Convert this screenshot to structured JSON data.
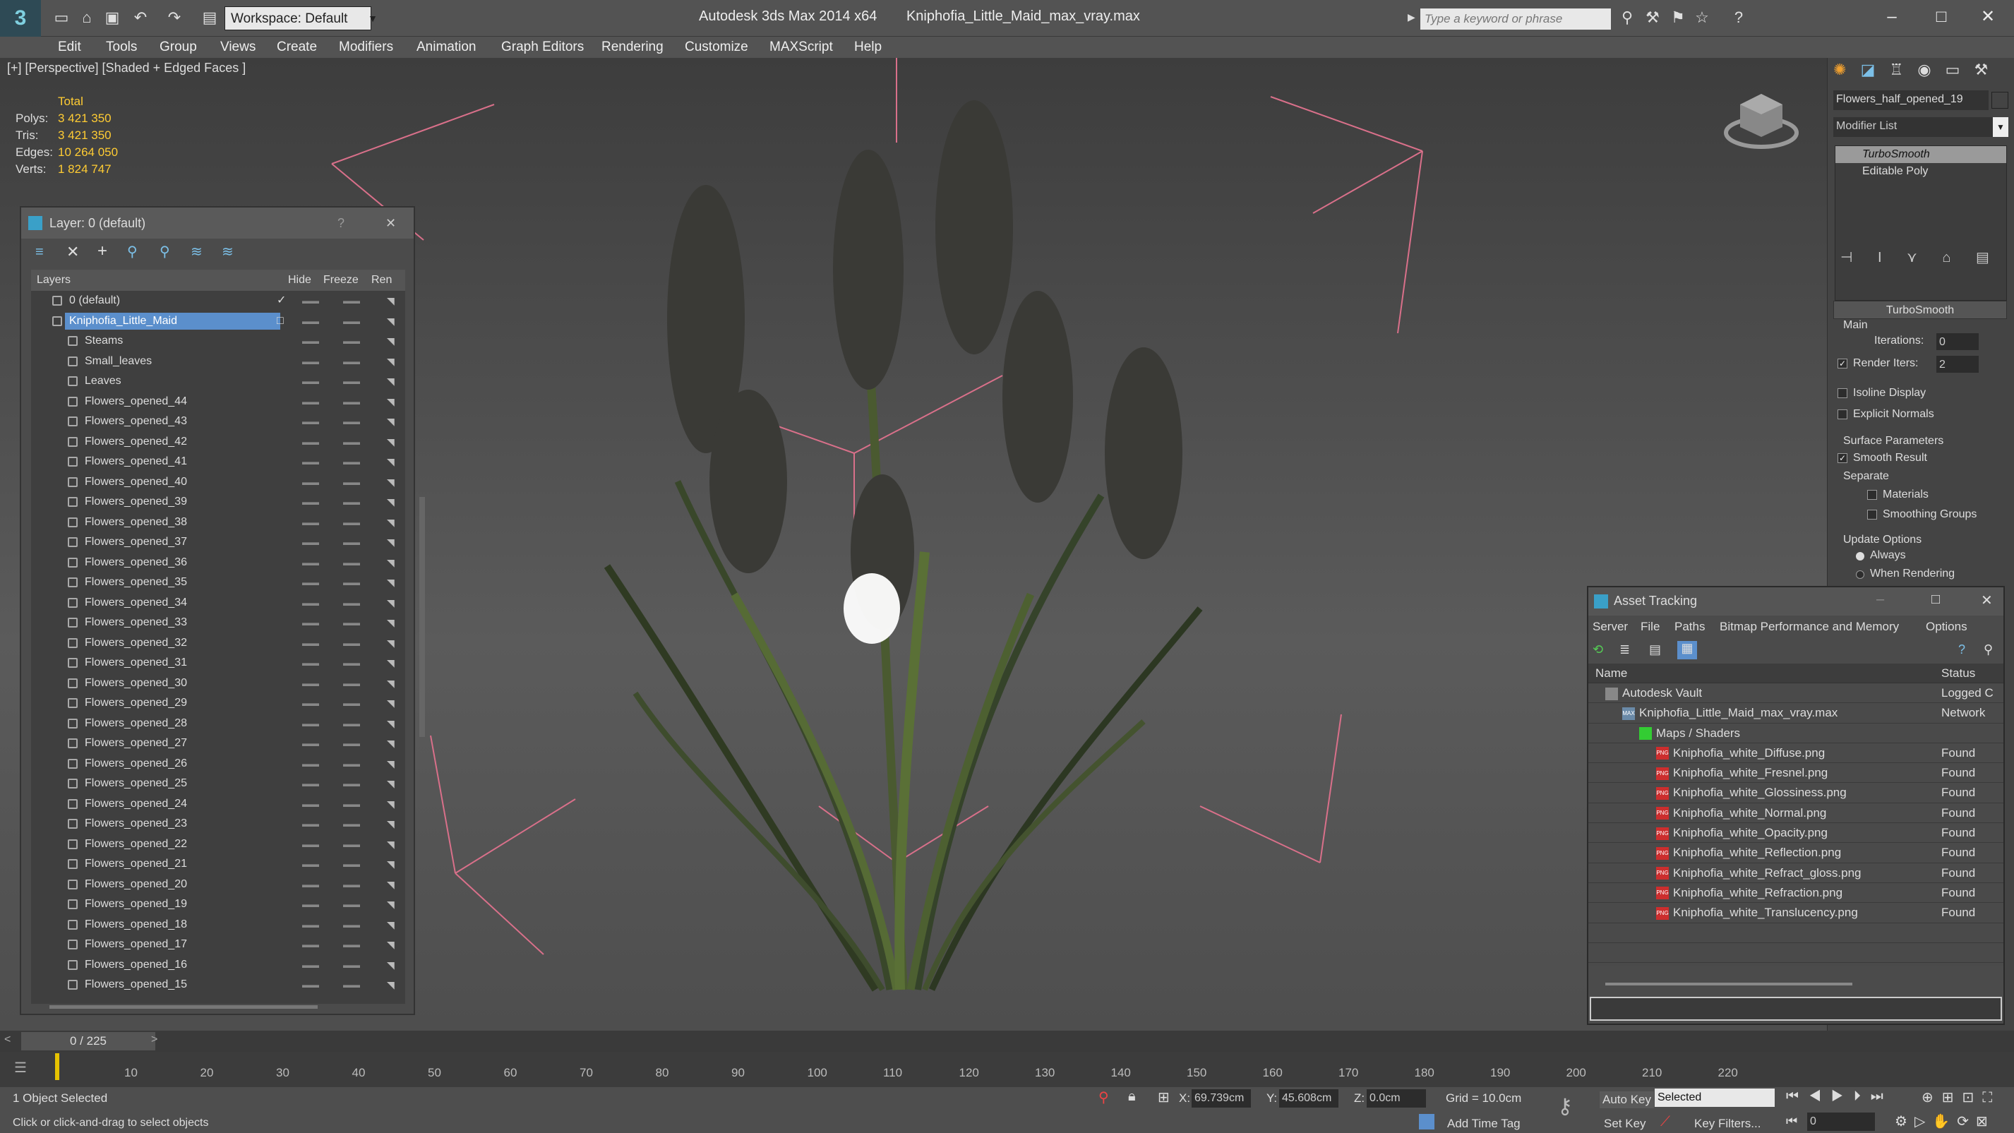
{
  "app": {
    "title": "Autodesk 3ds Max  2014 x64",
    "file": "Kniphofia_Little_Maid_max_vray.max",
    "logo_icon": "3ds-max-logo-icon",
    "workspace": "Workspace: Default",
    "search_placeholder": "Type a keyword or phrase"
  },
  "menu": [
    "Edit",
    "Tools",
    "Group",
    "Views",
    "Create",
    "Modifiers",
    "Animation",
    "Graph Editors",
    "Rendering",
    "Customize",
    "MAXScript",
    "Help"
  ],
  "viewport": {
    "label": "[+] [Perspective] [Shaded + Edged Faces ]",
    "stats": {
      "header": "Total",
      "rows": [
        {
          "k": "Polys:",
          "v": "3 421 350"
        },
        {
          "k": "Tris:",
          "v": "3 421 350"
        },
        {
          "k": "Edges:",
          "v": "10 264 050"
        },
        {
          "k": "Verts:",
          "v": "1 824 747"
        }
      ]
    }
  },
  "layer_window": {
    "title": "Layer: 0 (default)",
    "help": "?",
    "close": "✕",
    "columns": {
      "layers": "Layers",
      "hide": "Hide",
      "freeze": "Freeze",
      "render": "Ren"
    },
    "rows": [
      {
        "name": "0 (default)",
        "level": 0,
        "check": "✓"
      },
      {
        "name": "Kniphofia_Little_Maid",
        "level": 0,
        "selected": true,
        "check": "□"
      },
      {
        "name": "Steams",
        "level": 1
      },
      {
        "name": "Small_leaves",
        "level": 1
      },
      {
        "name": "Leaves",
        "level": 1
      },
      {
        "name": "Flowers_opened_44",
        "level": 1
      },
      {
        "name": "Flowers_opened_43",
        "level": 1
      },
      {
        "name": "Flowers_opened_42",
        "level": 1
      },
      {
        "name": "Flowers_opened_41",
        "level": 1
      },
      {
        "name": "Flowers_opened_40",
        "level": 1
      },
      {
        "name": "Flowers_opened_39",
        "level": 1
      },
      {
        "name": "Flowers_opened_38",
        "level": 1
      },
      {
        "name": "Flowers_opened_37",
        "level": 1
      },
      {
        "name": "Flowers_opened_36",
        "level": 1
      },
      {
        "name": "Flowers_opened_35",
        "level": 1
      },
      {
        "name": "Flowers_opened_34",
        "level": 1
      },
      {
        "name": "Flowers_opened_33",
        "level": 1
      },
      {
        "name": "Flowers_opened_32",
        "level": 1
      },
      {
        "name": "Flowers_opened_31",
        "level": 1
      },
      {
        "name": "Flowers_opened_30",
        "level": 1
      },
      {
        "name": "Flowers_opened_29",
        "level": 1
      },
      {
        "name": "Flowers_opened_28",
        "level": 1
      },
      {
        "name": "Flowers_opened_27",
        "level": 1
      },
      {
        "name": "Flowers_opened_26",
        "level": 1
      },
      {
        "name": "Flowers_opened_25",
        "level": 1
      },
      {
        "name": "Flowers_opened_24",
        "level": 1
      },
      {
        "name": "Flowers_opened_23",
        "level": 1
      },
      {
        "name": "Flowers_opened_22",
        "level": 1
      },
      {
        "name": "Flowers_opened_21",
        "level": 1
      },
      {
        "name": "Flowers_opened_20",
        "level": 1
      },
      {
        "name": "Flowers_opened_19",
        "level": 1
      },
      {
        "name": "Flowers_opened_18",
        "level": 1
      },
      {
        "name": "Flowers_opened_17",
        "level": 1
      },
      {
        "name": "Flowers_opened_16",
        "level": 1
      },
      {
        "name": "Flowers_opened_15",
        "level": 1
      }
    ]
  },
  "command_panel": {
    "object_name": "Flowers_half_opened_19",
    "modifier_list": "Modifier List",
    "stack": [
      "TurboSmooth",
      "Editable Poly"
    ],
    "rollout_title": "TurboSmooth",
    "main_label": "Main",
    "iterations_label": "Iterations:",
    "iterations_value": "0",
    "render_iters_label": "Render Iters:",
    "render_iters_value": "2",
    "isoline": "Isoline Display",
    "explicit": "Explicit Normals",
    "surface_params": "Surface Parameters",
    "smooth_result": "Smooth Result",
    "separate": "Separate",
    "materials": "Materials",
    "smoothing_groups": "Smoothing Groups",
    "update_options": "Update Options",
    "always": "Always",
    "when_rendering": "When Rendering"
  },
  "asset_tracking": {
    "title": "Asset Tracking",
    "menu": [
      "Server",
      "File",
      "Paths",
      "Bitmap Performance and Memory",
      "Options"
    ],
    "col_name": "Name",
    "col_status": "Status",
    "rows": [
      {
        "name": "Autodesk Vault",
        "status": "Logged C",
        "level": 0,
        "icon": "vault"
      },
      {
        "name": "Kniphofia_Little_Maid_max_vray.max",
        "status": "Network",
        "level": 1,
        "icon": "max"
      },
      {
        "name": "Maps / Shaders",
        "status": "",
        "level": 2,
        "icon": "folder"
      },
      {
        "name": "Kniphofia_white_Diffuse.png",
        "status": "Found",
        "level": 3,
        "icon": "png"
      },
      {
        "name": "Kniphofia_white_Fresnel.png",
        "status": "Found",
        "level": 3,
        "icon": "png"
      },
      {
        "name": "Kniphofia_white_Glossiness.png",
        "status": "Found",
        "level": 3,
        "icon": "png"
      },
      {
        "name": "Kniphofia_white_Normal.png",
        "status": "Found",
        "level": 3,
        "icon": "png"
      },
      {
        "name": "Kniphofia_white_Opacity.png",
        "status": "Found",
        "level": 3,
        "icon": "png"
      },
      {
        "name": "Kniphofia_white_Reflection.png",
        "status": "Found",
        "level": 3,
        "icon": "png"
      },
      {
        "name": "Kniphofia_white_Refract_gloss.png",
        "status": "Found",
        "level": 3,
        "icon": "png"
      },
      {
        "name": "Kniphofia_white_Refraction.png",
        "status": "Found",
        "level": 3,
        "icon": "png"
      },
      {
        "name": "Kniphofia_white_Translucency.png",
        "status": "Found",
        "level": 3,
        "icon": "png"
      }
    ]
  },
  "timeline": {
    "frame": "0 / 225",
    "ticks": [
      "10",
      "20",
      "30",
      "40",
      "50",
      "60",
      "70",
      "80",
      "90",
      "100",
      "110",
      "120",
      "130",
      "140",
      "150",
      "160",
      "170",
      "180",
      "190",
      "200",
      "210",
      "220"
    ]
  },
  "status": {
    "selected": "1 Object Selected",
    "prompt": "Click or click-and-drag to select objects",
    "x_label": "X:",
    "x": "69.739cm",
    "y_label": "Y:",
    "y": "45.608cm",
    "z_label": "Z:",
    "z": "0.0cm",
    "grid": "Grid = 10.0cm",
    "add_time_tag": "Add Time Tag",
    "auto_key": "Auto Key",
    "set_key": "Set Key",
    "key_mode": "Selected",
    "key_filters": "Key Filters...",
    "frame_field": "0"
  }
}
